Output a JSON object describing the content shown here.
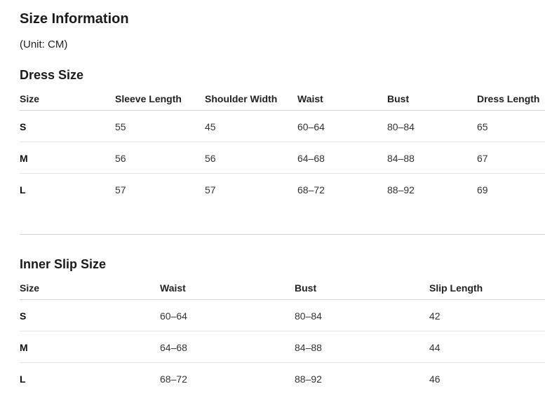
{
  "header": {
    "title": "Size Information",
    "unit": "(Unit: CM)"
  },
  "dress": {
    "title": "Dress Size",
    "columns": [
      "Size",
      "Sleeve Length",
      "Shoulder Width",
      "Waist",
      "Bust",
      "Dress Length"
    ],
    "rows": [
      [
        "S",
        "55",
        "45",
        "60–64",
        "80–84",
        "65"
      ],
      [
        "M",
        "56",
        "56",
        "64–68",
        "84–88",
        "67"
      ],
      [
        "L",
        "57",
        "57",
        "68–72",
        "88–92",
        "69"
      ]
    ]
  },
  "slip": {
    "title": "Inner Slip Size",
    "columns": [
      "Size",
      "Waist",
      "Bust",
      "Slip Length"
    ],
    "rows": [
      [
        "S",
        "60–64",
        "80–84",
        "42"
      ],
      [
        "M",
        "64–68",
        "84–88",
        "44"
      ],
      [
        "L",
        "68–72",
        "88–92",
        "46"
      ]
    ]
  }
}
